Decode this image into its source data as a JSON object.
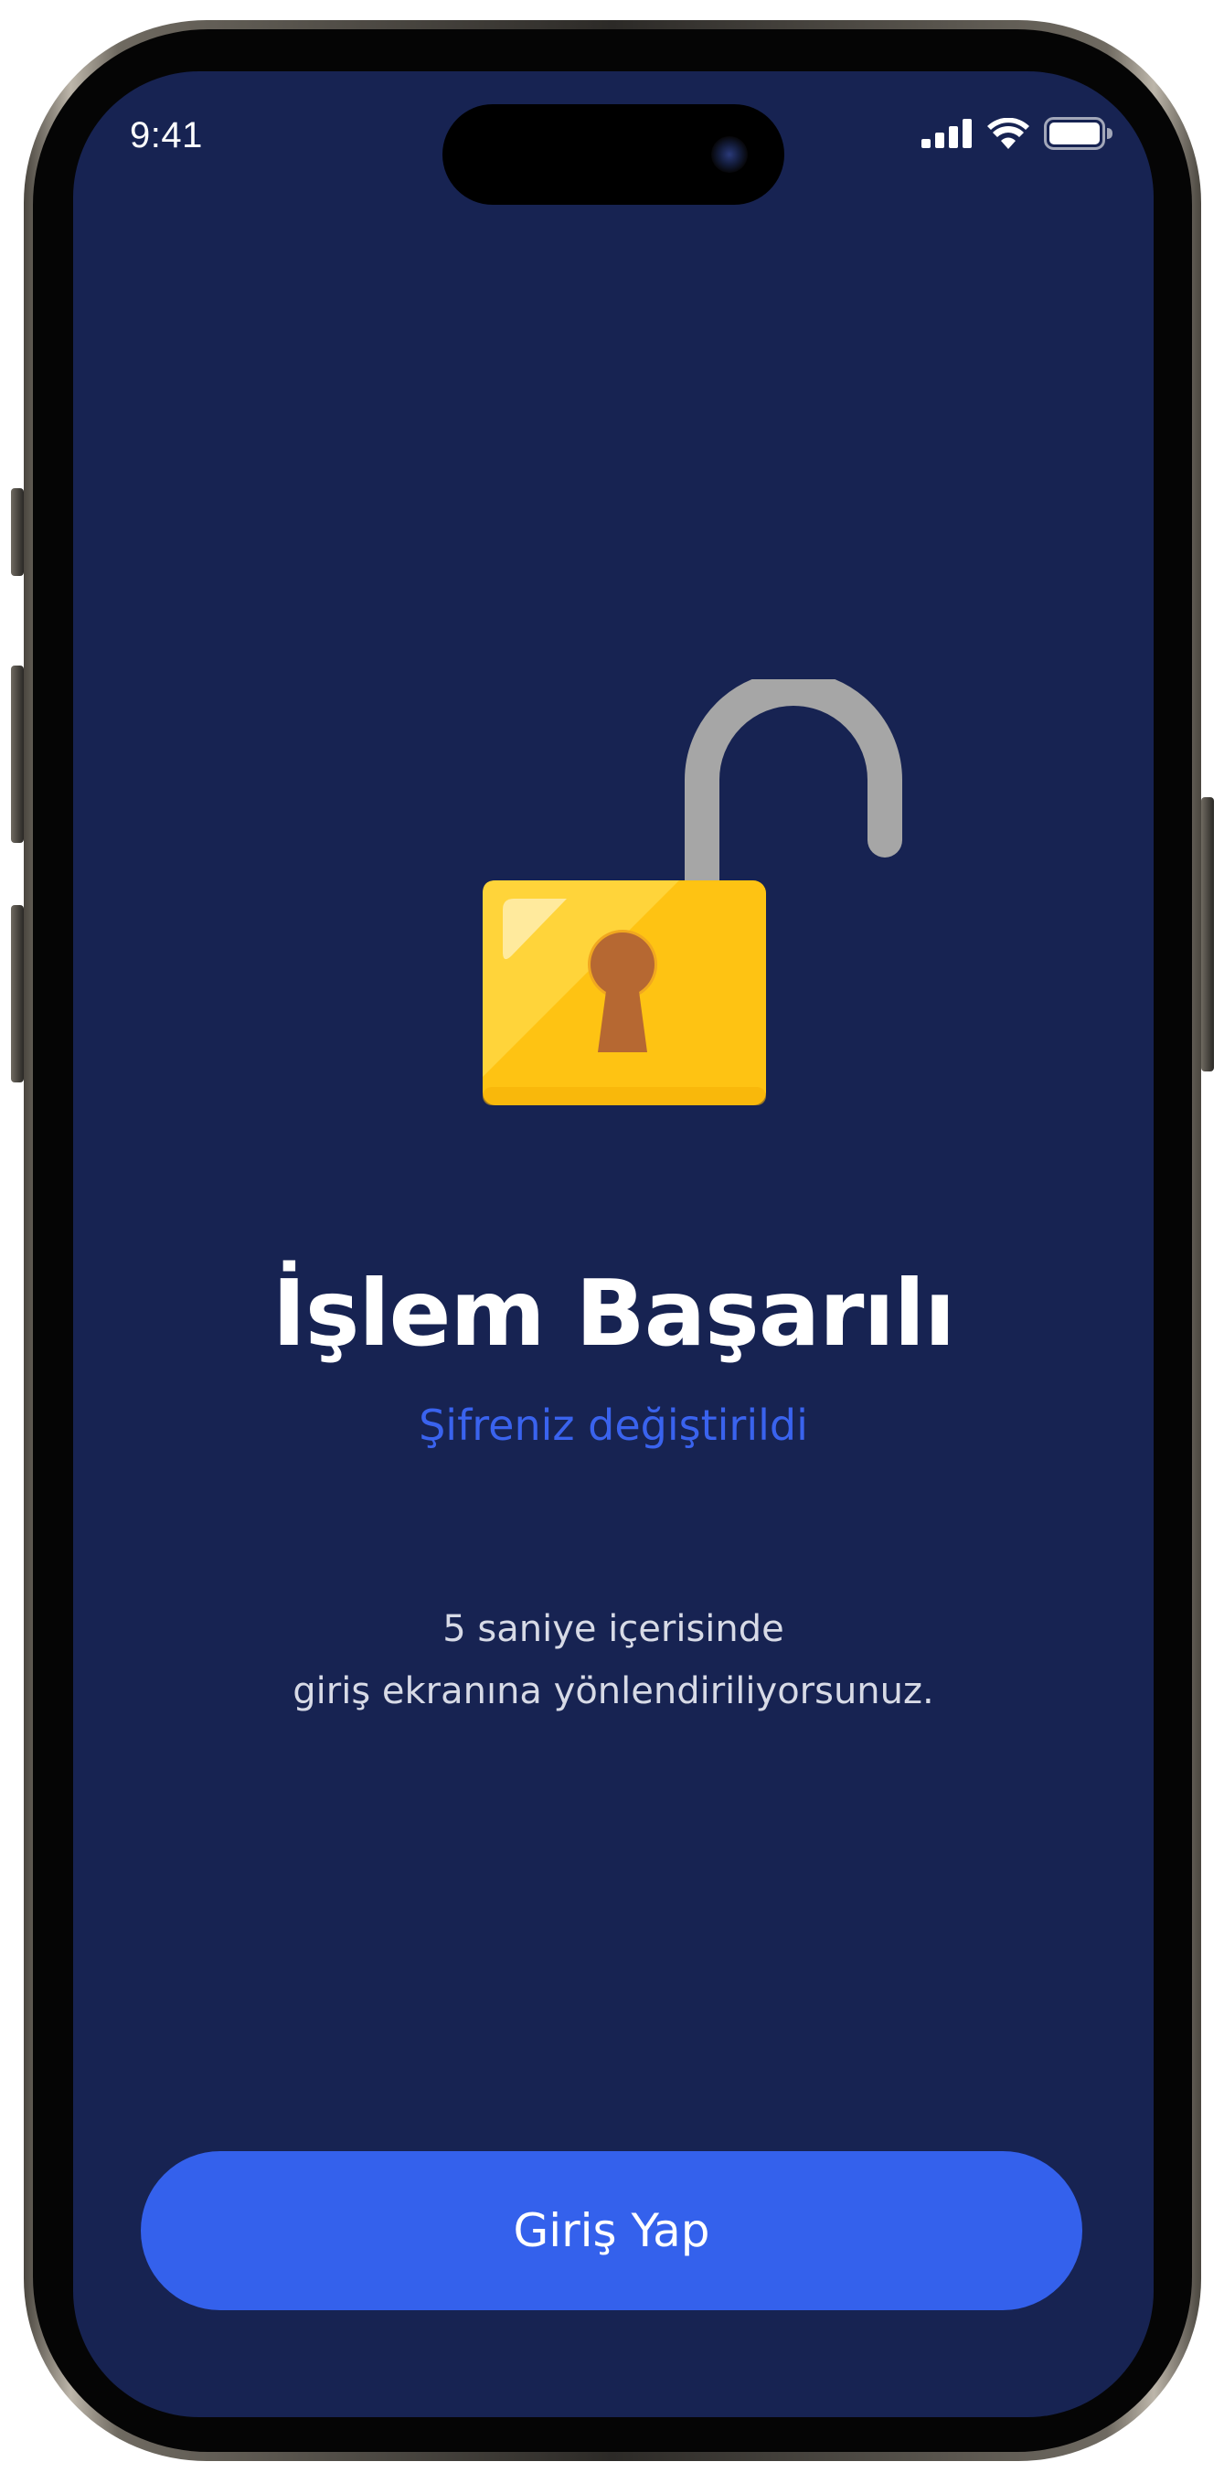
{
  "status_bar": {
    "time": "9:41",
    "icons": [
      "cellular-signal-icon",
      "wifi-icon",
      "battery-icon"
    ]
  },
  "illustration": {
    "icon": "unlocked-padlock-icon",
    "colors": {
      "body": "#fec313",
      "shackle": "#a6a6a6",
      "keyhole": "#b66832"
    }
  },
  "content": {
    "title": "İşlem Başarılı",
    "subtitle": "Şifreniz değiştirildi",
    "message_lines": [
      "5 saniye içerisinde",
      "giriş ekranına yönlendiriliyorsunuz."
    ]
  },
  "actions": {
    "login_label": "Giriş Yap"
  },
  "colors": {
    "background": "#172352",
    "accent": "#3461ec",
    "subtitle": "#3a63ee",
    "title": "#ffffff"
  }
}
